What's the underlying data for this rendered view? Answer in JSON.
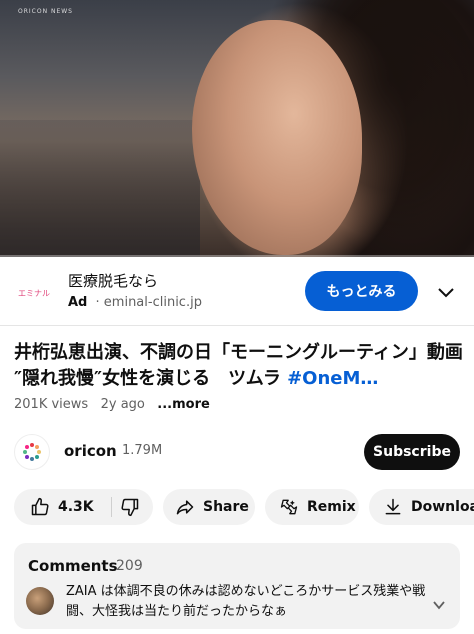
{
  "video": {
    "watermark": "ORICON NEWS",
    "progress_fraction": 0.0
  },
  "ad": {
    "logo_text": "エミナル",
    "title": "医療脱毛なら",
    "badge": "Ad",
    "separator": "·",
    "domain": "eminal-clinic.jp",
    "cta_label": "もっとみる"
  },
  "video_info": {
    "title_text": "井桁弘恵出演、不調の日「モーニングルーティン」動画　″隠れ我慢″女性を演じる　ツムラ ",
    "title_hashtag": "#OneM…",
    "views": "201K views",
    "age": "2y ago",
    "more_label": "...more"
  },
  "channel": {
    "name": "oricon",
    "subscribers": "1.79M",
    "subscribe_label": "Subscribe"
  },
  "actions": {
    "like_count": "4.3K",
    "share_label": "Share",
    "remix_label": "Remix",
    "download_label": "Download"
  },
  "comments": {
    "heading": "Comments",
    "count": "209",
    "top_comment": "ZAIA は体調不良の休みは認めないどころかサービス残業や戦闘、大怪我は当たり前だったからなぁ"
  },
  "colors": {
    "accent_blue": "#065fd4",
    "subscribe_bg": "#0f0f0f",
    "pill_bg": "#f2f2f2"
  },
  "icons": [
    "chevron-down-icon",
    "thumbs-up-icon",
    "thumbs-down-icon",
    "share-icon",
    "remix-icon",
    "download-icon"
  ]
}
